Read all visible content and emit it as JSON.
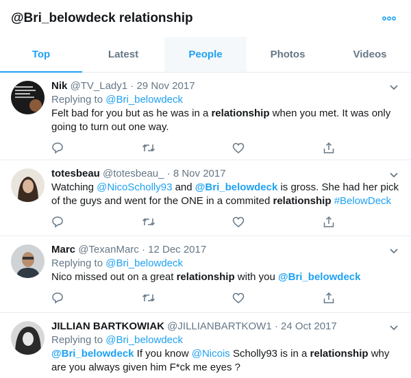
{
  "header": {
    "title": "@Bri_belowdeck relationship"
  },
  "tabs": [
    {
      "label": "Top"
    },
    {
      "label": "Latest"
    },
    {
      "label": "People"
    },
    {
      "label": "Photos"
    },
    {
      "label": "Videos"
    }
  ],
  "colors": {
    "accent": "#1da1f2",
    "secondary_text": "#657786",
    "divider": "#e6ecf0"
  },
  "tweets": [
    {
      "name": "Nik",
      "handle": "@TV_Lady1",
      "separator": "·",
      "date": "29 Nov 2017",
      "replying_prefix": "Replying to",
      "replying_to": "@Bri_belowdeck",
      "text": [
        {
          "t": "Felt bad for you but as he was in a "
        },
        {
          "t": "relationship",
          "style": "bold"
        },
        {
          "t": " when you met. It was only going to turn out one way."
        }
      ],
      "icons": [
        "reply-icon",
        "retweet-icon",
        "like-icon",
        "share-icon"
      ]
    },
    {
      "name": "totesbeau",
      "handle": "@totesbeau_",
      "separator": "·",
      "date": "8 Nov 2017",
      "text": [
        {
          "t": "Watching "
        },
        {
          "t": "@NicoScholly93",
          "style": "link"
        },
        {
          "t": " and "
        },
        {
          "t": "@Bri_belowdeck",
          "style": "link-bold"
        },
        {
          "t": " is gross. She had her pick of the guys and went for the ONE in a commited "
        },
        {
          "t": "relationship",
          "style": "bold"
        },
        {
          "t": " "
        },
        {
          "t": "#BelowDeck",
          "style": "link"
        }
      ],
      "icons": [
        "reply-icon",
        "retweet-icon",
        "like-icon",
        "share-icon"
      ]
    },
    {
      "name": "Marc",
      "handle": "@TexanMarc",
      "separator": "·",
      "date": "12 Dec 2017",
      "replying_prefix": "Replying to",
      "replying_to": "@Bri_belowdeck",
      "text": [
        {
          "t": "Nico missed out on a great "
        },
        {
          "t": "relationship",
          "style": "bold"
        },
        {
          "t": " with you "
        },
        {
          "t": "@Bri_belowdeck",
          "style": "link-bold"
        }
      ],
      "icons": [
        "reply-icon",
        "retweet-icon",
        "like-icon",
        "share-icon"
      ]
    },
    {
      "name": "JILLIAN BARTKOWIAK",
      "handle": "@JILLIANBARTKOW1",
      "separator": "·",
      "date": "24 Oct 2017",
      "replying_prefix": "Replying to",
      "replying_to": "@Bri_belowdeck",
      "text": [
        {
          "t": "@Bri_belowdeck",
          "style": "link-bold"
        },
        {
          "t": " If you know "
        },
        {
          "t": "@Nicois",
          "style": "link"
        },
        {
          "t": " Scholly93 is in a "
        },
        {
          "t": "relationship",
          "style": "bold"
        },
        {
          "t": " why are you always given him F*ck me eyes ?"
        }
      ],
      "icons": [
        "reply-icon",
        "retweet-icon",
        "like-icon",
        "share-icon"
      ]
    }
  ]
}
